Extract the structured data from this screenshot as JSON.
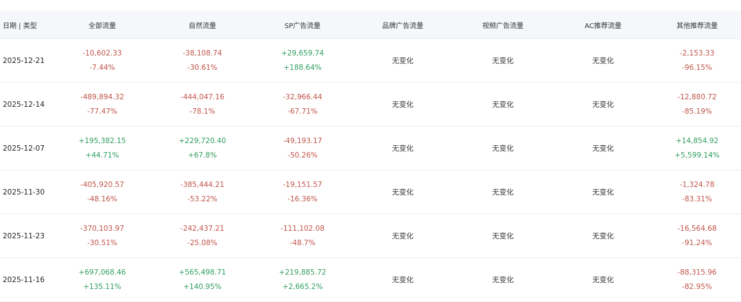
{
  "colors": {
    "negative": "#c0554a",
    "positive": "#2f9e5f",
    "header_bg": "#f5f7fa"
  },
  "headers": {
    "date": "日期 | 类型",
    "total": "全部流量",
    "natural": "自然流量",
    "sp": "SP广告流量",
    "brand": "品牌广告流量",
    "video": "视频广告流量",
    "ac": "AC推荐流量",
    "other": "其他推荐流量"
  },
  "rows": [
    {
      "date": "2025-12-21",
      "total": {
        "abs": "-10,602.33",
        "pct": "-7.44%"
      },
      "natural": {
        "abs": "-38,108.74",
        "pct": "-30.61%"
      },
      "sp": {
        "abs": "+29,659.74",
        "pct": "+188.64%"
      },
      "brand": "无变化",
      "video": "无变化",
      "ac": "无变化",
      "other": {
        "abs": "-2,153.33",
        "pct": "-96.15%"
      }
    },
    {
      "date": "2025-12-14",
      "total": {
        "abs": "-489,894.32",
        "pct": "-77.47%"
      },
      "natural": {
        "abs": "-444,047.16",
        "pct": "-78.1%"
      },
      "sp": {
        "abs": "-32,966.44",
        "pct": "-67.71%"
      },
      "brand": "无变化",
      "video": "无变化",
      "ac": "无变化",
      "other": {
        "abs": "-12,880.72",
        "pct": "-85.19%"
      }
    },
    {
      "date": "2025-12-07",
      "total": {
        "abs": "+195,382.15",
        "pct": "+44.71%"
      },
      "natural": {
        "abs": "+229,720.40",
        "pct": "+67.8%"
      },
      "sp": {
        "abs": "-49,193.17",
        "pct": "-50.26%"
      },
      "brand": "无变化",
      "video": "无变化",
      "ac": "无变化",
      "other": {
        "abs": "+14,854.92",
        "pct": "+5,599.14%"
      }
    },
    {
      "date": "2025-11-30",
      "total": {
        "abs": "-405,920.57",
        "pct": "-48.16%"
      },
      "natural": {
        "abs": "-385,444.21",
        "pct": "-53.22%"
      },
      "sp": {
        "abs": "-19,151.57",
        "pct": "-16.36%"
      },
      "brand": "无变化",
      "video": "无变化",
      "ac": "无变化",
      "other": {
        "abs": "-1,324.78",
        "pct": "-83.31%"
      }
    },
    {
      "date": "2025-11-23",
      "total": {
        "abs": "-370,103.97",
        "pct": "-30.51%"
      },
      "natural": {
        "abs": "-242,437.21",
        "pct": "-25.08%"
      },
      "sp": {
        "abs": "-111,102.08",
        "pct": "-48.7%"
      },
      "brand": "无变化",
      "video": "无变化",
      "ac": "无变化",
      "other": {
        "abs": "-16,564.68",
        "pct": "-91.24%"
      }
    },
    {
      "date": "2025-11-16",
      "total": {
        "abs": "+697,068.46",
        "pct": "+135.11%"
      },
      "natural": {
        "abs": "+565,498.71",
        "pct": "+140.95%"
      },
      "sp": {
        "abs": "+219,885.72",
        "pct": "+2,665.2%"
      },
      "brand": "无变化",
      "video": "无变化",
      "ac": "无变化",
      "other": {
        "abs": "-88,315.96",
        "pct": "-82.95%"
      }
    }
  ]
}
